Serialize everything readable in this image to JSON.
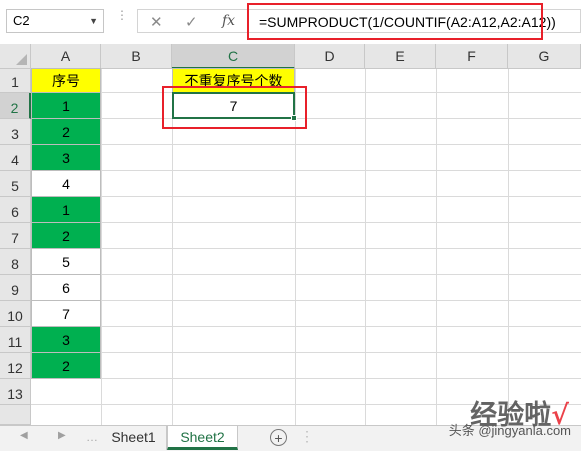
{
  "formula_bar": {
    "name_box": "C2",
    "cancel_icon": "✕",
    "enter_icon": "✓",
    "fx_label": "fx",
    "formula": "=SUMPRODUCT(1/COUNTIF(A2:A12,A2:A12))"
  },
  "columns": [
    "A",
    "B",
    "C",
    "D",
    "E",
    "F",
    "G"
  ],
  "rows": [
    "1",
    "2",
    "3",
    "4",
    "5",
    "6",
    "7",
    "8",
    "9",
    "10",
    "11",
    "12",
    "13"
  ],
  "selected_cell": "C2",
  "cells": {
    "A1": "序号",
    "A2": "1",
    "A3": "2",
    "A4": "3",
    "A5": "4",
    "A6": "1",
    "A7": "2",
    "A8": "5",
    "A9": "6",
    "A10": "7",
    "A11": "3",
    "A12": "2",
    "C1": "不重复序号个数",
    "C2": "7"
  },
  "colors": {
    "green_fill": "#00b050",
    "yellow_fill": "#ffff00",
    "highlight_red": "#e8202a",
    "excel_green": "#217346"
  },
  "sheet_tabs": [
    {
      "label": "Sheet1",
      "active": false
    },
    {
      "label": "Sheet2",
      "active": true
    }
  ],
  "watermark": {
    "main": "经验啦",
    "check": "√",
    "sub": "头条 @jingyanla.com"
  }
}
